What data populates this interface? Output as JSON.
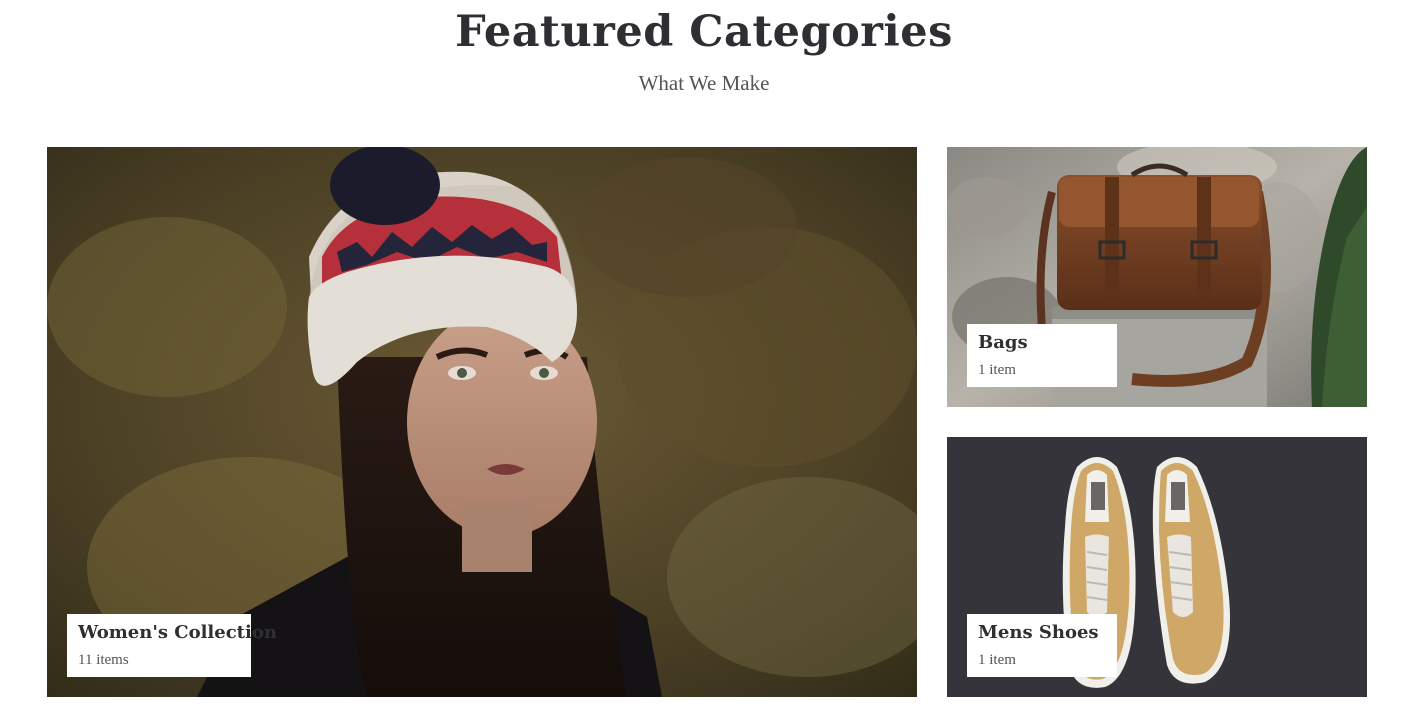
{
  "header": {
    "title": "Featured Categories",
    "subtitle": "What We Make"
  },
  "categories": [
    {
      "name": "Women's Collection",
      "count": "11 items",
      "image": "woman-in-knit-beanie-photo"
    },
    {
      "name": "Bags",
      "count": "1 item",
      "image": "leather-messenger-bag-photo"
    },
    {
      "name": "Mens Shoes",
      "count": "1 item",
      "image": "tan-canvas-sneakers-photo"
    }
  ],
  "colors": {
    "heading": "#2f2f33",
    "subtext": "#555555",
    "label_bg": "#ffffff",
    "shoes_bg": "#35343a"
  }
}
